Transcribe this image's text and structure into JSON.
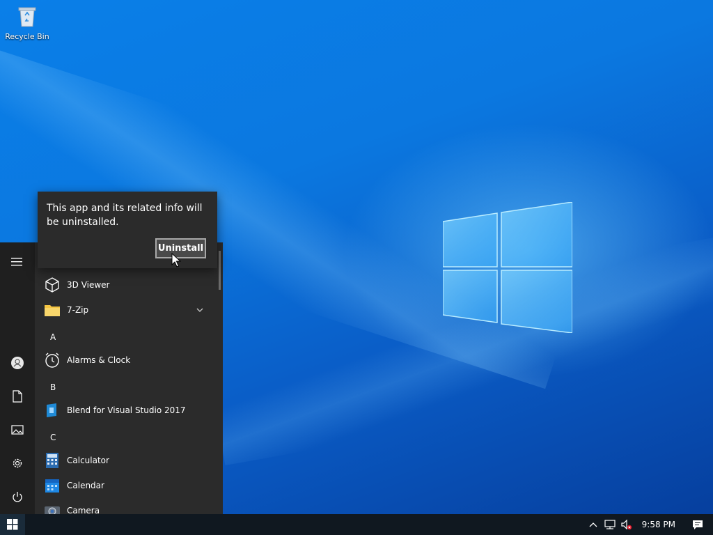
{
  "desktop": {
    "icons": [
      {
        "label": "Recycle Bin",
        "icon": "recycle-bin-icon"
      }
    ]
  },
  "flyout": {
    "message": "This app and its related info will be uninstalled.",
    "button_label": "Uninstall"
  },
  "start_menu": {
    "rail": [
      "hamburger-menu-icon",
      "user-account-icon",
      "documents-icon",
      "pictures-icon",
      "settings-icon",
      "power-icon"
    ],
    "apps": [
      {
        "label": "3D Viewer",
        "icon": "3d-viewer-icon"
      },
      {
        "label": "7-Zip",
        "icon": "folder-icon",
        "expandable": true
      },
      {
        "letter": "A"
      },
      {
        "label": "Alarms & Clock",
        "icon": "alarm-clock-icon"
      },
      {
        "letter": "B"
      },
      {
        "label": "Blend for Visual Studio 2017",
        "icon": "blend-icon"
      },
      {
        "letter": "C"
      },
      {
        "label": "Calculator",
        "icon": "calculator-icon"
      },
      {
        "label": "Calendar",
        "icon": "calendar-icon"
      },
      {
        "label": "Camera",
        "icon": "camera-icon"
      }
    ]
  },
  "taskbar": {
    "clock": "9:58 PM",
    "tray_icons": [
      "chevron-up-icon",
      "network-icon",
      "volume-muted-icon",
      "notifications-icon"
    ]
  },
  "colors": {
    "accent": "#0a78e0",
    "menu_bg": "#2b2b2b",
    "taskbar_bg": "#101820"
  }
}
